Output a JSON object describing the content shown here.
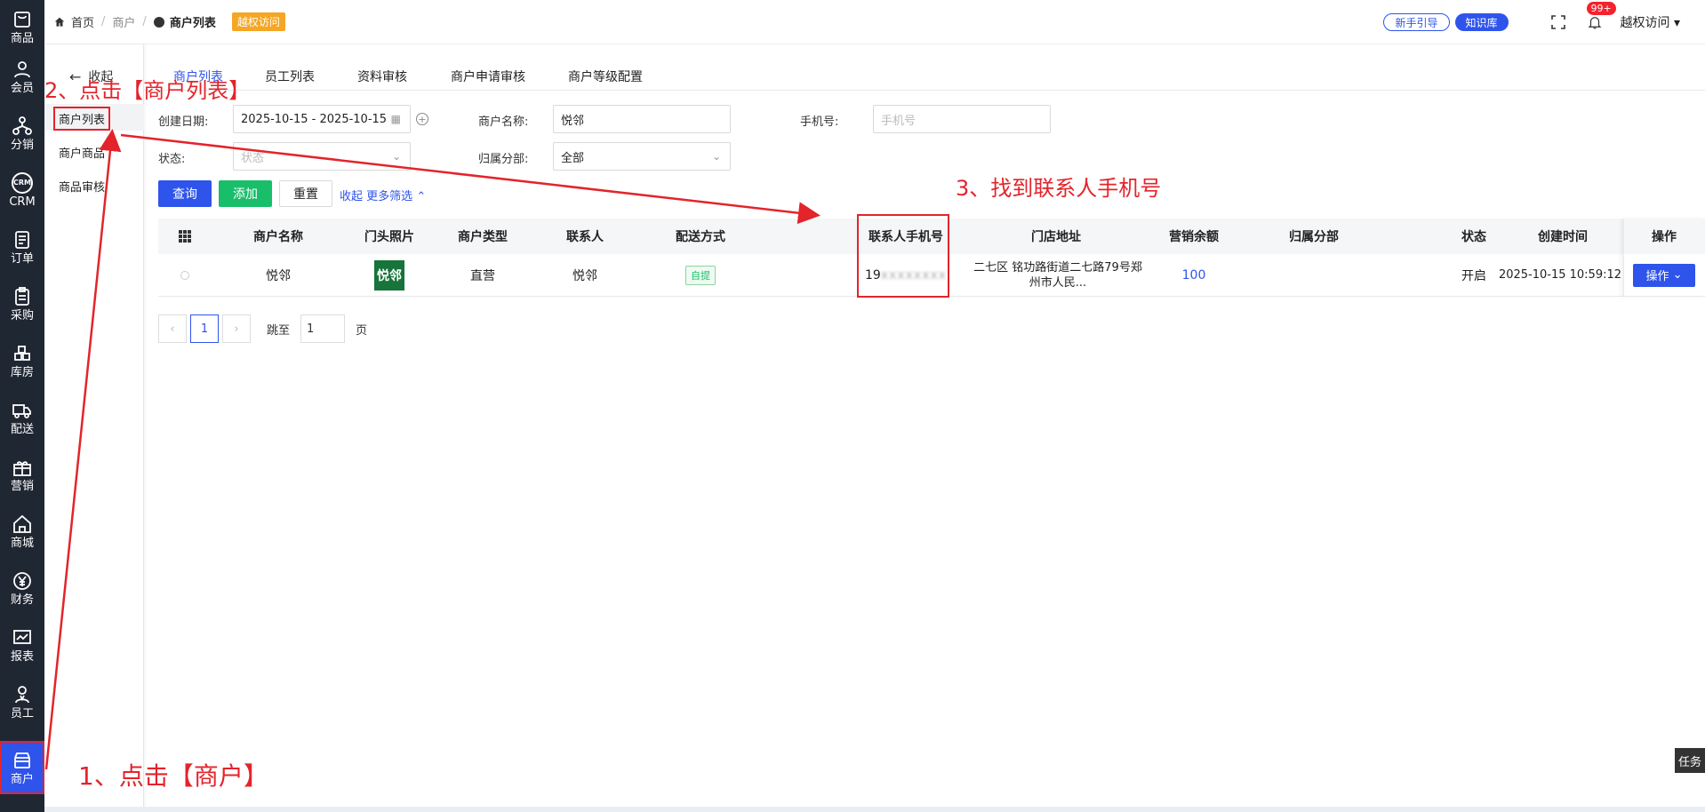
{
  "nav": {
    "items": [
      {
        "label": "商品",
        "icon": "bag-icon"
      },
      {
        "label": "会员",
        "icon": "user-icon"
      },
      {
        "label": "分销",
        "icon": "network-icon"
      },
      {
        "label": "CRM",
        "icon": "crm-icon"
      },
      {
        "label": "订单",
        "icon": "order-icon"
      },
      {
        "label": "采购",
        "icon": "clipboard-icon"
      },
      {
        "label": "库房",
        "icon": "boxes-icon"
      },
      {
        "label": "配送",
        "icon": "truck-icon"
      },
      {
        "label": "营销",
        "icon": "gift-icon"
      },
      {
        "label": "商城",
        "icon": "home-icon"
      },
      {
        "label": "财务",
        "icon": "yen-icon"
      },
      {
        "label": "报表",
        "icon": "chart-icon"
      },
      {
        "label": "员工",
        "icon": "staff-icon"
      },
      {
        "label": "商户",
        "icon": "store-icon"
      }
    ]
  },
  "topbar": {
    "home": "首页",
    "crumb_merchant": "商户",
    "crumb_current": "商户列表",
    "tag": "越权访问",
    "guide_btn": "新手引导",
    "kb_btn": "知识库",
    "notify_count": "99+",
    "user": "越权访问"
  },
  "subnav": {
    "collapse": "收起",
    "items": [
      "商户列表",
      "商户商品",
      "商品审核"
    ]
  },
  "tabs": [
    "商户列表",
    "员工列表",
    "资料审核",
    "商户申请审核",
    "商户等级配置"
  ],
  "filters": {
    "date_label": "创建日期:",
    "date_value": "2025-10-15 - 2025-10-15",
    "name_label": "商户名称:",
    "name_value": "悦邻",
    "phone_label": "手机号:",
    "phone_placeholder": "手机号",
    "status_label": "状态:",
    "status_placeholder": "状态",
    "branch_label": "归属分部:",
    "branch_value": "全部"
  },
  "actions": {
    "query": "查询",
    "add": "添加",
    "reset": "重置",
    "collapse": "收起",
    "more": "更多筛选"
  },
  "table": {
    "headers": [
      "商户名称",
      "门头照片",
      "商户类型",
      "联系人",
      "配送方式",
      "联系人手机号",
      "门店地址",
      "营销余额",
      "归属分部",
      "状态",
      "创建时间",
      "操作"
    ],
    "rows": [
      {
        "name": "悦邻",
        "photo_text": "悦邻",
        "type": "直营",
        "contact": "悦邻",
        "delivery": "自提",
        "phone_prefix": "19",
        "phone_masked": "xxxxxxxx",
        "address": "二七区 铭功路街道二七路79号郑州市人民...",
        "balance": "100",
        "branch": "",
        "status": "开启",
        "created": "2025-10-15 10:59:12",
        "op": "操作"
      }
    ]
  },
  "pager": {
    "current": "1",
    "jump_label": "跳至",
    "jump_value": "1",
    "page_unit": "页"
  },
  "annotations": {
    "step1": "1、点击【商户】",
    "step2": "2、点击【商户列表】",
    "step3": "3、找到联系人手机号"
  },
  "task_btn": "任务",
  "colors": {
    "primary": "#2f54eb",
    "green": "#19be6b",
    "annotation": "#e3242b",
    "nav_bg": "#1f2733"
  }
}
